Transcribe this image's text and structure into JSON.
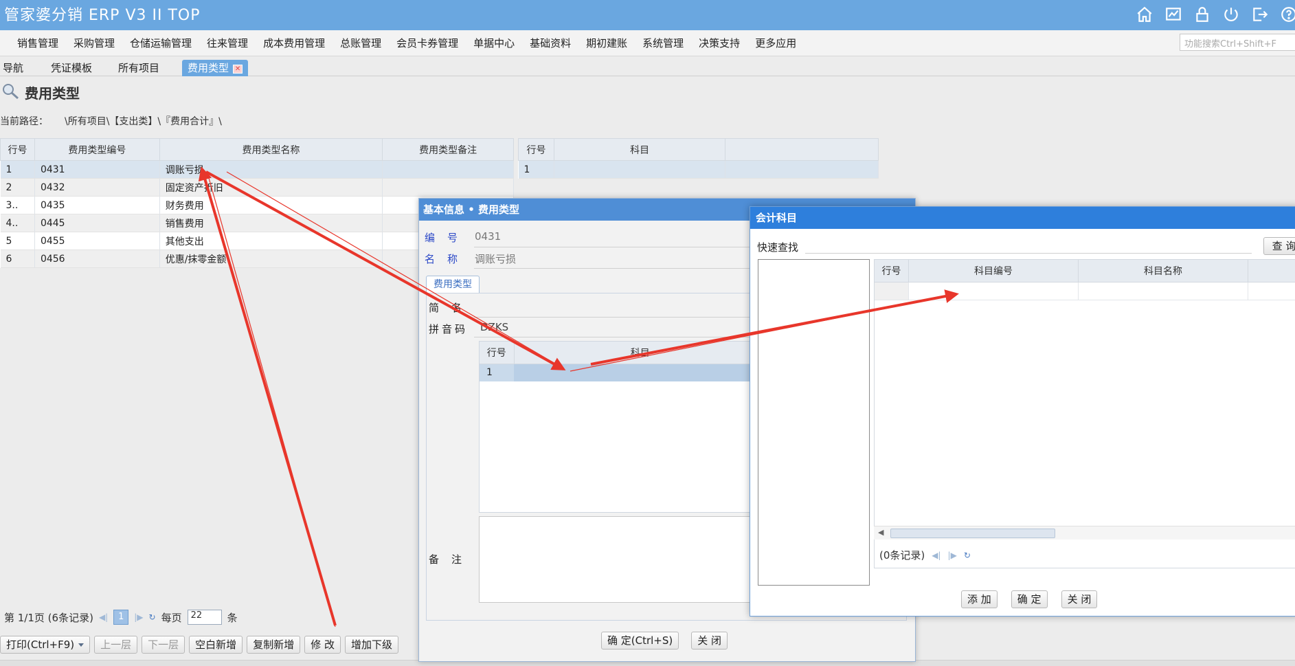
{
  "app": {
    "title": "管家婆分销 ERP V3 II TOP"
  },
  "menu": [
    "销售管理",
    "采购管理",
    "仓储运输管理",
    "往来管理",
    "成本费用管理",
    "总账管理",
    "会员卡券管理",
    "单据中心",
    "基础资料",
    "期初建账",
    "系统管理",
    "决策支持",
    "更多应用"
  ],
  "search": {
    "placeholder": "功能搜索Ctrl+Shift+F"
  },
  "tabs": [
    {
      "label": "导航"
    },
    {
      "label": "凭证模板"
    },
    {
      "label": "所有项目"
    },
    {
      "label": "费用类型",
      "active": true
    }
  ],
  "page": {
    "title": "费用类型",
    "path_label": "当前路径：",
    "path_value": "\\所有项目\\【支出类】\\『费用合计』\\"
  },
  "main_grid": {
    "columns": [
      "行号",
      "费用类型编号",
      "费用类型名称",
      "费用类型备注"
    ],
    "rows": [
      [
        "1",
        "0431",
        "调账亏损",
        ""
      ],
      [
        "2",
        "0432",
        "固定资产折旧",
        ""
      ],
      [
        "3..",
        "0435",
        "财务费用",
        ""
      ],
      [
        "4..",
        "0445",
        "销售费用",
        ""
      ],
      [
        "5",
        "0455",
        "其他支出",
        ""
      ],
      [
        "6",
        "0456",
        "优惠/抹零金额",
        ""
      ]
    ]
  },
  "right_grid": {
    "columns": [
      "行号",
      "科目"
    ],
    "rows": [
      [
        "1",
        ""
      ]
    ]
  },
  "pager": {
    "page_info": "第 1/1页 (6条记录)",
    "current_page": "1",
    "per_page_label": "每页",
    "per_page_value": "22",
    "unit": "条"
  },
  "toolbar": {
    "print": "打印(Ctrl+F9)",
    "up_level": "上一层",
    "down_level": "下一层",
    "blank_new": "空白新增",
    "copy_new": "复制新增",
    "modify": "修 改",
    "add_sub": "增加下级"
  },
  "dialog_basic": {
    "title": "基本信息 • 费用类型",
    "code_label": "编号",
    "code_value": "0431",
    "name_label": "名称",
    "name_value": "调账亏损",
    "tab_label": "费用类型",
    "short_label": "简名",
    "pinyin_label": "拼音码",
    "pinyin_value": "DZKS",
    "grid_columns": [
      "行号",
      "科目"
    ],
    "grid_rows": [
      [
        "1",
        ""
      ]
    ],
    "remark_label": "备注",
    "ok_button": "确 定(Ctrl+S)",
    "close_button": "关 闭"
  },
  "dialog_account": {
    "title": "会计科目",
    "quick_search_label": "快速查找",
    "query_button": "查 询",
    "columns": [
      "行号",
      "科目编号",
      "科目名称"
    ],
    "record_info": "(0条记录)",
    "add_button": "添 加",
    "ok_button": "确 定",
    "close_button": "关 闭"
  },
  "colors": {
    "title_bar": "#6aa7e0",
    "dialog_header": "#4f8ed6",
    "account_header": "#2e7fdc",
    "arrow": "#e8362b"
  }
}
